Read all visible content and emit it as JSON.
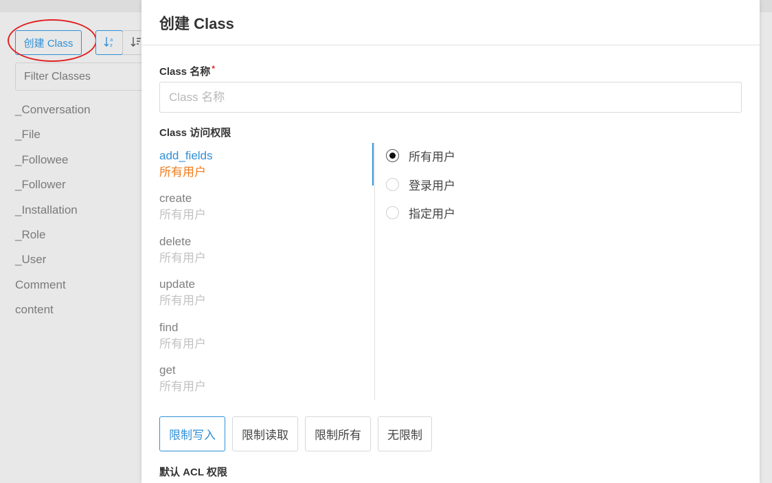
{
  "sidebar": {
    "create_button": "创建 Class",
    "sort_alpha_icon": "↓a z",
    "sort_list_icon": "↓≡",
    "filter_placeholder": "Filter Classes",
    "classes": [
      "_Conversation",
      "_File",
      "_Followee",
      "_Follower",
      "_Installation",
      "_Role",
      "_User",
      "Comment",
      "content"
    ]
  },
  "modal": {
    "title": "创建 Class",
    "name_label": "Class 名称",
    "required_mark": "*",
    "name_placeholder": "Class 名称",
    "access_label": "Class 访问权限",
    "permissions": [
      {
        "name": "add_fields",
        "value": "所有用户",
        "active": true
      },
      {
        "name": "create",
        "value": "所有用户"
      },
      {
        "name": "delete",
        "value": "所有用户"
      },
      {
        "name": "update",
        "value": "所有用户"
      },
      {
        "name": "find",
        "value": "所有用户"
      },
      {
        "name": "get",
        "value": "所有用户"
      }
    ],
    "radio_options": [
      {
        "label": "所有用户",
        "checked": true
      },
      {
        "label": "登录用户",
        "checked": false
      },
      {
        "label": "指定用户",
        "checked": false
      }
    ],
    "presets": [
      {
        "label": "限制写入",
        "active": true
      },
      {
        "label": "限制读取"
      },
      {
        "label": "限制所有"
      },
      {
        "label": "无限制"
      }
    ],
    "default_acl_label": "默认 ACL 权限"
  },
  "colors": {
    "accent": "#2e8fd6",
    "highlight_value": "#f27c1b",
    "annotation_circle": "#e02020"
  }
}
